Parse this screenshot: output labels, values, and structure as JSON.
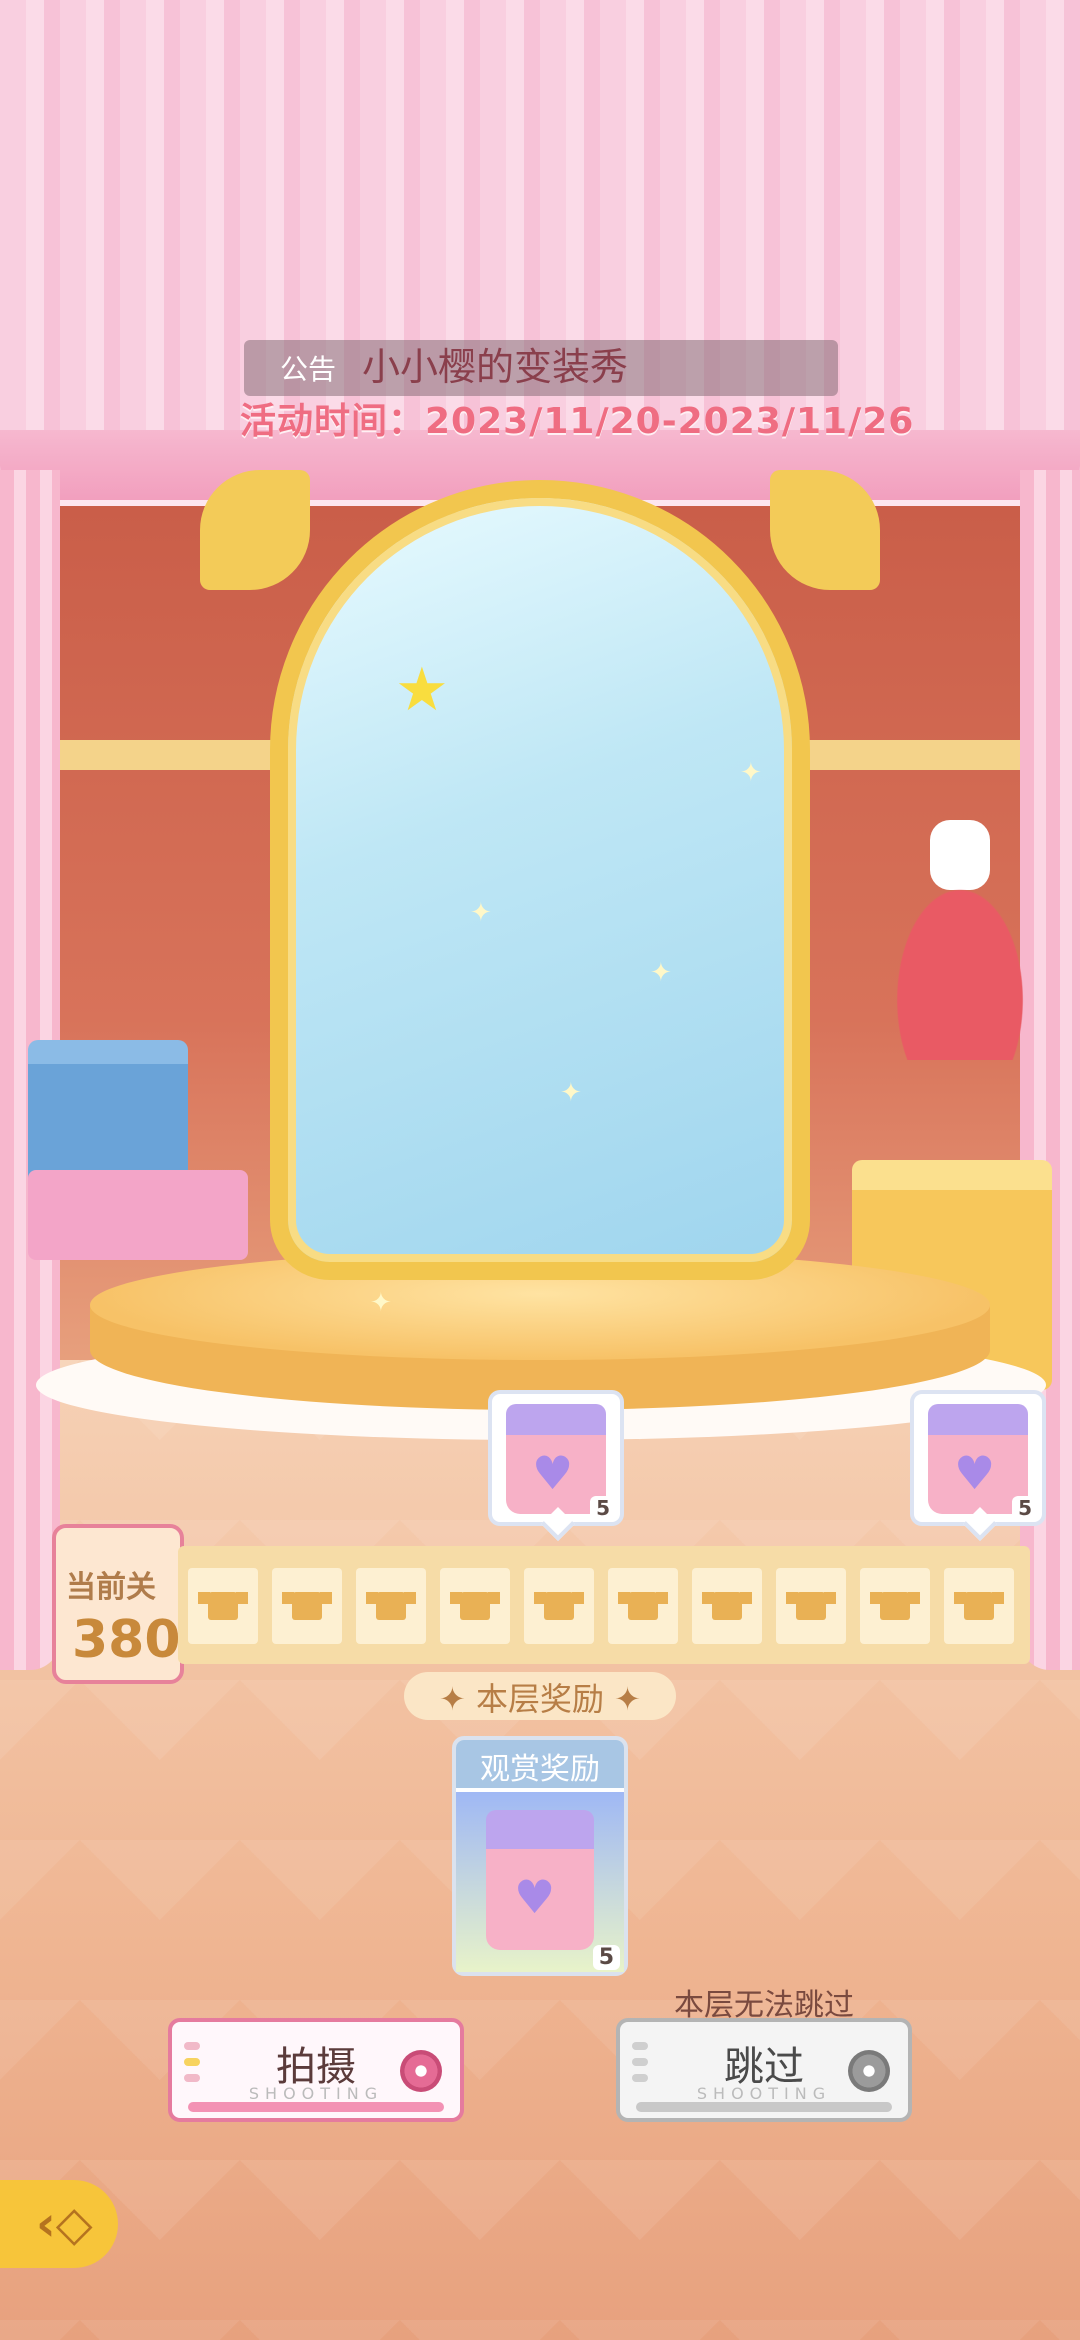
{
  "announcement": {
    "tag": "公告",
    "title": "小小樱的变装秀",
    "time": "活动时间：2023/11/20-2023/11/26"
  },
  "reward_previews": [
    {
      "icon": "reward-bag-icon",
      "quantity": "5"
    },
    {
      "icon": "reward-bag-icon",
      "quantity": "5"
    }
  ],
  "level": {
    "label": "当前关",
    "value": "380"
  },
  "film_strip": {
    "icon": "shirt-icon",
    "count": 10
  },
  "floor_reward": {
    "label": "✦ 本层奖励 ✦"
  },
  "view_reward": {
    "title": "观赏奖励",
    "quantity": "5",
    "icon": "reward-bag-icon"
  },
  "buttons": {
    "shoot": {
      "label": "拍摄",
      "sub": "SHOOTING"
    },
    "skip": {
      "label": "跳过",
      "sub": "SHOOTING",
      "note": "本层无法跳过"
    }
  },
  "back": {
    "icon": "back-arrow-icon"
  },
  "colors": {
    "accent_pink": "#e57b9e",
    "gold": "#f2c64e",
    "title_pink": "#ef6d82"
  }
}
